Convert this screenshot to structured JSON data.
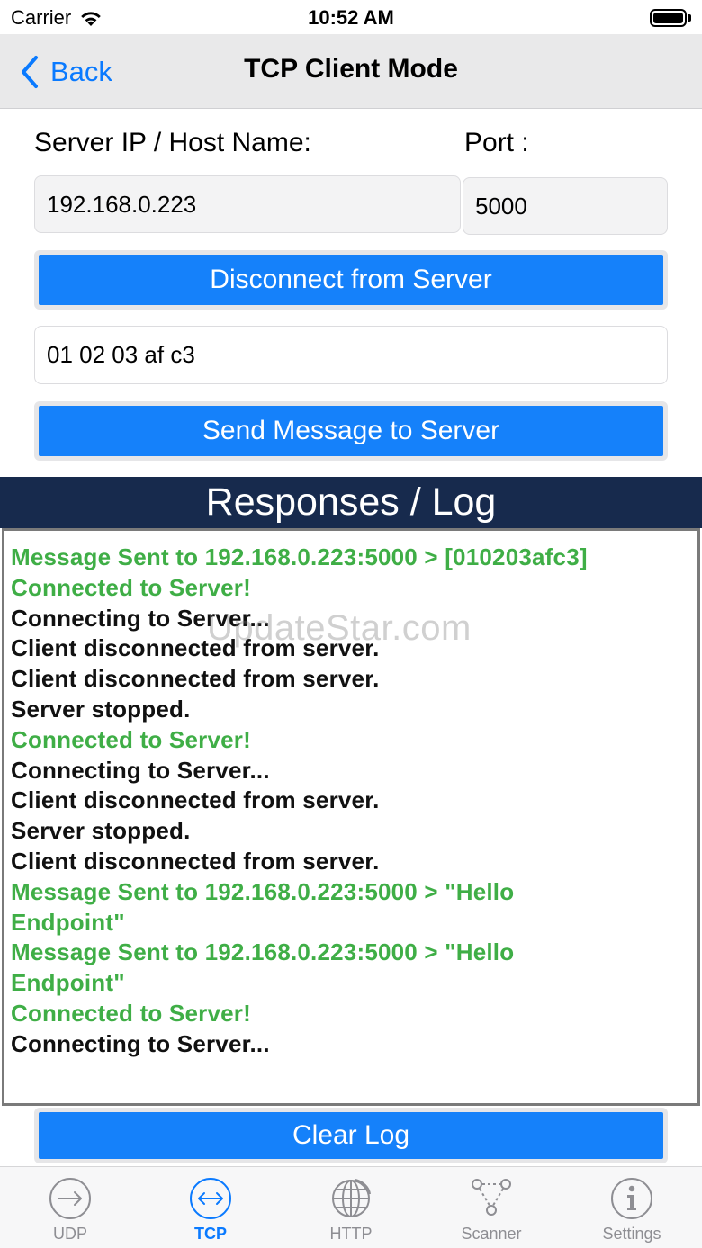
{
  "status_bar": {
    "carrier": "Carrier",
    "time": "10:52 AM"
  },
  "nav": {
    "back_label": "Back",
    "title": "TCP Client Mode"
  },
  "form": {
    "server_label": "Server IP / Host Name:",
    "port_label": "Port :",
    "server_value": "192.168.0.223",
    "port_value": "5000",
    "connect_button": "Disconnect from Server",
    "message_value": "01 02 03 af c3",
    "send_button": "Send Message to Server"
  },
  "log": {
    "title": "Responses / Log",
    "watermark": "UpdateStar.com",
    "colors": {
      "success": "#3fae46",
      "info": "#111111"
    },
    "lines": [
      {
        "text": "Message Sent to 192.168.0.223:5000 > [010203afc3]",
        "type": "success"
      },
      {
        "text": "Connected to Server!",
        "type": "success"
      },
      {
        "text": "Connecting to Server...",
        "type": "info"
      },
      {
        "text": "Client disconnected from server.",
        "type": "info"
      },
      {
        "text": "Client disconnected from server.",
        "type": "info"
      },
      {
        "text": "Server stopped.",
        "type": "info"
      },
      {
        "text": "Connected to Server!",
        "type": "success"
      },
      {
        "text": "Connecting to Server...",
        "type": "info"
      },
      {
        "text": "Client disconnected from server.",
        "type": "info"
      },
      {
        "text": "Server stopped.",
        "type": "info"
      },
      {
        "text": "Client disconnected from server.",
        "type": "info"
      },
      {
        "text": "Message Sent to 192.168.0.223:5000 > \"Hello",
        "type": "success"
      },
      {
        "text": "Endpoint\"",
        "type": "success"
      },
      {
        "text": "Message Sent to 192.168.0.223:5000 > \"Hello",
        "type": "success"
      },
      {
        "text": "Endpoint\"",
        "type": "success"
      },
      {
        "text": "Connected to Server!",
        "type": "success"
      },
      {
        "text": "Connecting to Server...",
        "type": "info"
      }
    ],
    "clear_button": "Clear Log"
  },
  "tabs": [
    {
      "label": "UDP",
      "icon": "arrow-right-circle-icon",
      "active": false
    },
    {
      "label": "TCP",
      "icon": "arrows-left-right-circle-icon",
      "active": true
    },
    {
      "label": "HTTP",
      "icon": "globe-icon",
      "active": false
    },
    {
      "label": "Scanner",
      "icon": "network-nodes-icon",
      "active": false
    },
    {
      "label": "Settings",
      "icon": "info-circle-icon",
      "active": false
    }
  ],
  "accent_color": "#0a7aff"
}
